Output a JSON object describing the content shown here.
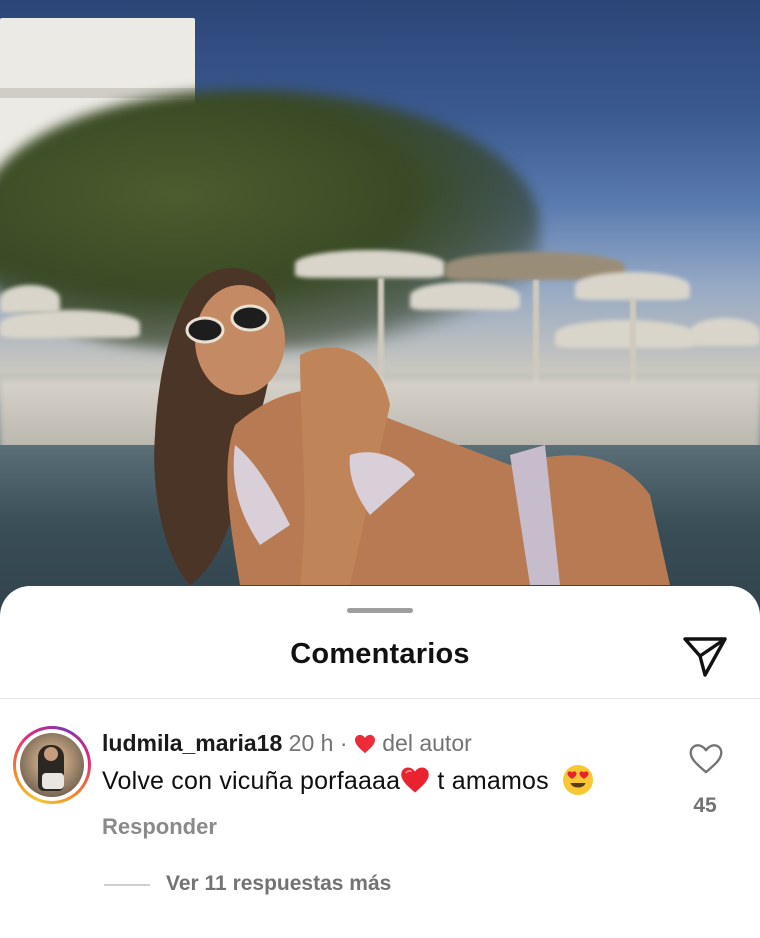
{
  "sheet": {
    "title": "Comentarios",
    "share_icon": "paper-plane-icon"
  },
  "comment": {
    "username": "ludmila_maria18",
    "time": "20 h",
    "separator": "·",
    "author_label": "del autor",
    "author_icon": "red-heart-icon",
    "text_part1": "Volve con vicuña porfaaaa",
    "text_part2": "t amamos",
    "reply_label": "Responder",
    "like_count": "45"
  },
  "replies": {
    "label": "Ver 11 respuestas más"
  },
  "colors": {
    "heart_red": "#ed2c3a",
    "muted_text": "#737373",
    "story_ring": [
      "#f9c530",
      "#f58529",
      "#dd2a7b",
      "#8134af"
    ]
  }
}
